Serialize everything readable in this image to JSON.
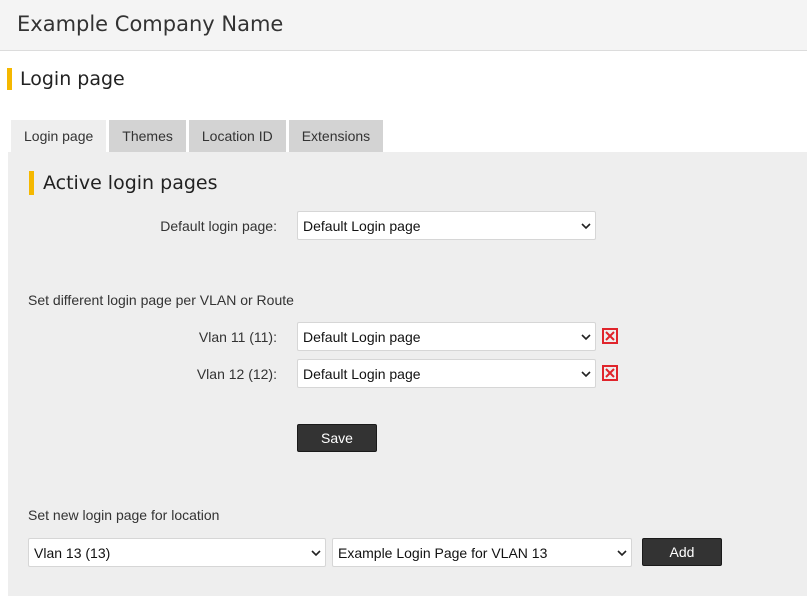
{
  "header": {
    "company_name": "Example Company Name"
  },
  "page": {
    "title": "Login page"
  },
  "tabs": [
    {
      "label": "Login page",
      "active": true
    },
    {
      "label": "Themes",
      "active": false
    },
    {
      "label": "Location ID",
      "active": false
    },
    {
      "label": "Extensions",
      "active": false
    }
  ],
  "active_section": {
    "title": "Active login pages",
    "default_label": "Default login page:",
    "default_value": "Default Login page"
  },
  "per_vlan": {
    "heading": "Set different login page per VLAN or Route",
    "rows": [
      {
        "label": "Vlan 11 (11):",
        "value": "Default Login page"
      },
      {
        "label": "Vlan 12 (12):",
        "value": "Default Login page"
      }
    ],
    "save_label": "Save"
  },
  "new_location": {
    "heading": "Set new login page for location",
    "location_value": "Vlan 13 (13)",
    "page_value": "Example Login Page for VLAN 13",
    "add_label": "Add"
  },
  "icons": {
    "dropdown": "chevron-down-icon",
    "delete": "close-icon"
  },
  "colors": {
    "accent": "#f5b800",
    "delete": "#e0242b",
    "button": "#333333",
    "panel": "#eeeeee",
    "tab_inactive": "#d3d3d3"
  }
}
